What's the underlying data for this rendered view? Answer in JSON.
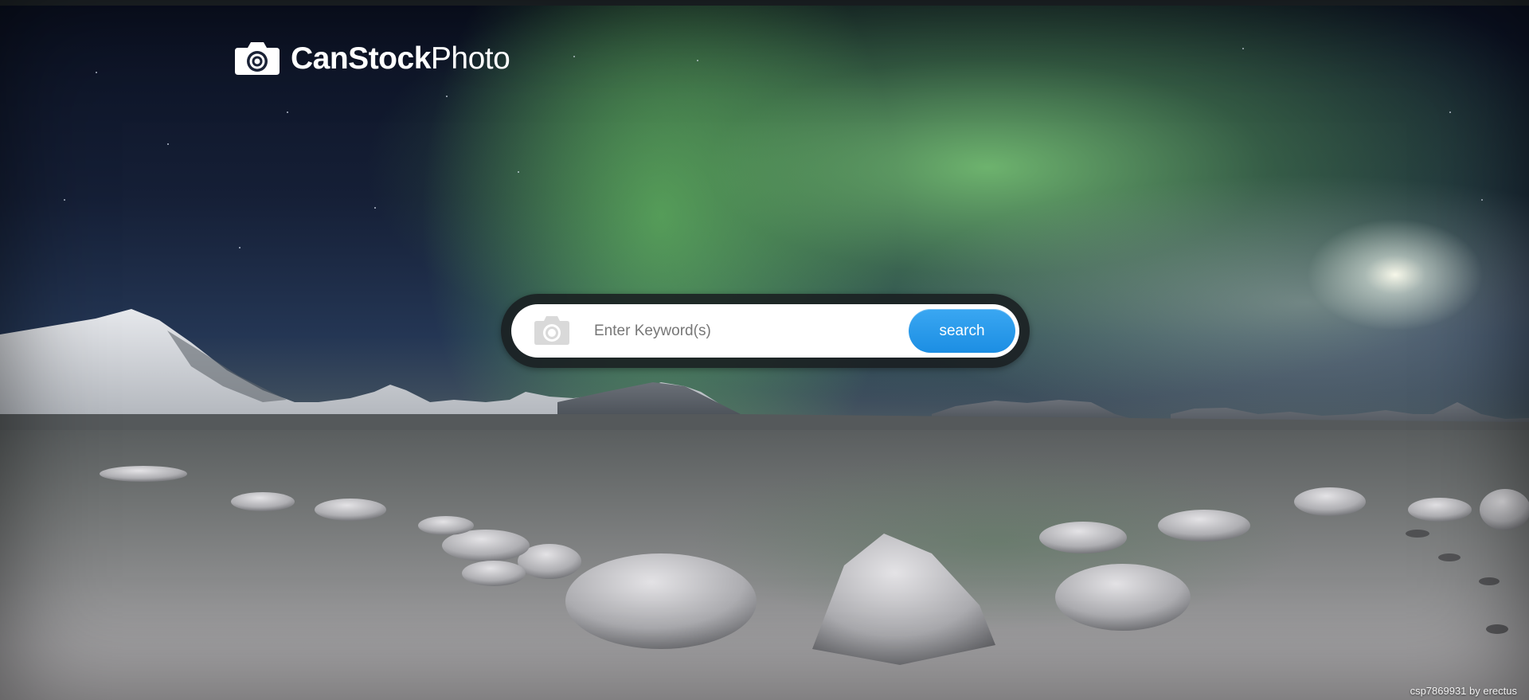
{
  "logo": {
    "text_bold": "CanStock",
    "text_light": "Photo"
  },
  "search": {
    "placeholder": "Enter Keyword(s)",
    "value": "",
    "button_label": "search"
  },
  "credit": "csp7869931 by erectus",
  "colors": {
    "accent": "#1c8ee3",
    "aurora": "#7dcd78",
    "search_frame": "#191e20"
  },
  "icons": [
    "camera-logo-icon",
    "camera-icon"
  ]
}
